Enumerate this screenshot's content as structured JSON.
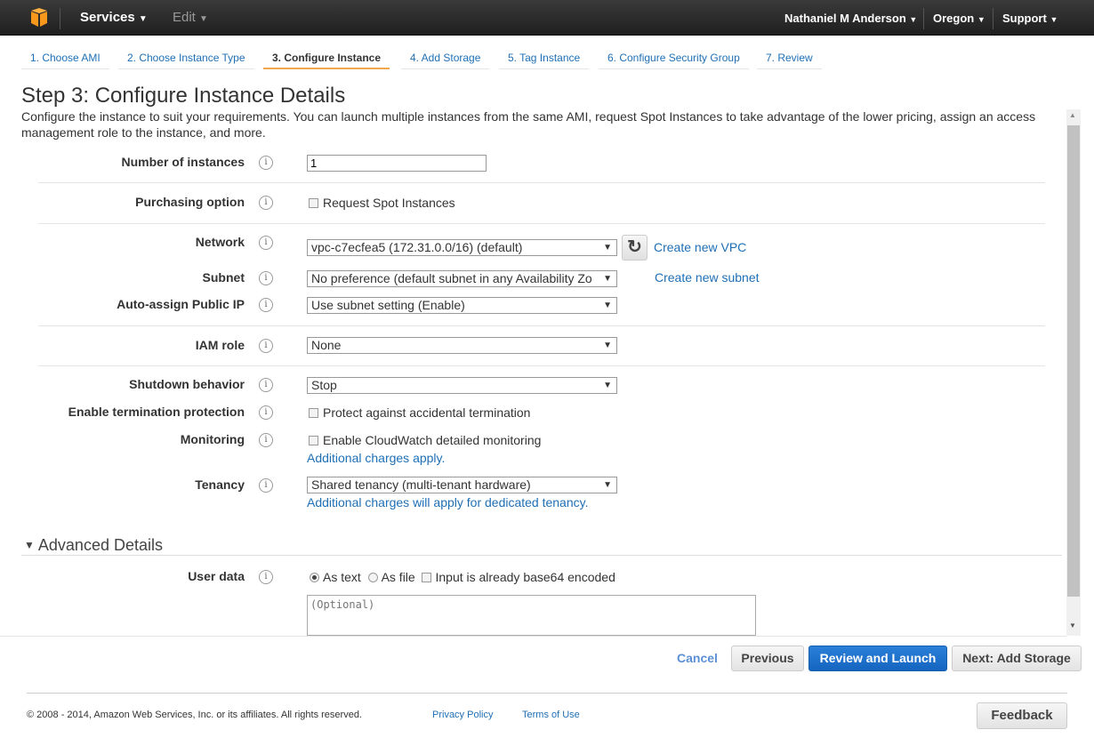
{
  "header": {
    "services": "Services",
    "edit": "Edit",
    "user": "Nathaniel M Anderson",
    "region": "Oregon",
    "support": "Support"
  },
  "tabs": [
    {
      "label": "1. Choose AMI"
    },
    {
      "label": "2. Choose Instance Type"
    },
    {
      "label": "3. Configure Instance",
      "active": true
    },
    {
      "label": "4. Add Storage"
    },
    {
      "label": "5. Tag Instance"
    },
    {
      "label": "6. Configure Security Group"
    },
    {
      "label": "7. Review"
    }
  ],
  "page": {
    "title": "Step 3: Configure Instance Details",
    "description": "Configure the instance to suit your requirements. You can launch multiple instances from the same AMI, request Spot Instances to take advantage of the lower pricing, assign an access management role to the instance, and more."
  },
  "form": {
    "instances": {
      "label": "Number of instances",
      "value": "1"
    },
    "purchasing": {
      "label": "Purchasing option",
      "checkbox": "Request Spot Instances"
    },
    "network": {
      "label": "Network",
      "value": "vpc-c7ecfea5 (172.31.0.0/16) (default)",
      "link": "Create new VPC"
    },
    "subnet": {
      "label": "Subnet",
      "value": "No preference (default subnet in any Availability Zo",
      "link": "Create new subnet"
    },
    "public_ip": {
      "label": "Auto-assign Public IP",
      "value": "Use subnet setting (Enable)"
    },
    "iam": {
      "label": "IAM role",
      "value": "None"
    },
    "shutdown": {
      "label": "Shutdown behavior",
      "value": "Stop"
    },
    "termination": {
      "label": "Enable termination protection",
      "checkbox": "Protect against accidental termination"
    },
    "monitoring": {
      "label": "Monitoring",
      "checkbox": "Enable CloudWatch detailed monitoring",
      "note": "Additional charges apply."
    },
    "tenancy": {
      "label": "Tenancy",
      "value": "Shared tenancy (multi-tenant hardware)",
      "note": "Additional charges will apply for dedicated tenancy."
    },
    "advanced": {
      "title": "Advanced Details"
    },
    "user_data": {
      "label": "User data",
      "as_text": "As text",
      "as_file": "As file",
      "base64": "Input is already base64 encoded",
      "placeholder": "(Optional)"
    }
  },
  "actions": {
    "cancel": "Cancel",
    "previous": "Previous",
    "review": "Review and Launch",
    "next": "Next: Add Storage"
  },
  "footer": {
    "copyright": "© 2008 - 2014, Amazon Web Services, Inc. or its affiliates. All rights reserved.",
    "privacy": "Privacy Policy",
    "terms": "Terms of Use",
    "feedback": "Feedback"
  },
  "colors": {
    "accent": "#1f6fb5",
    "primary_button": "#1a6fcc",
    "active_tab": "#f0a64a",
    "logo": "#f7981d"
  }
}
